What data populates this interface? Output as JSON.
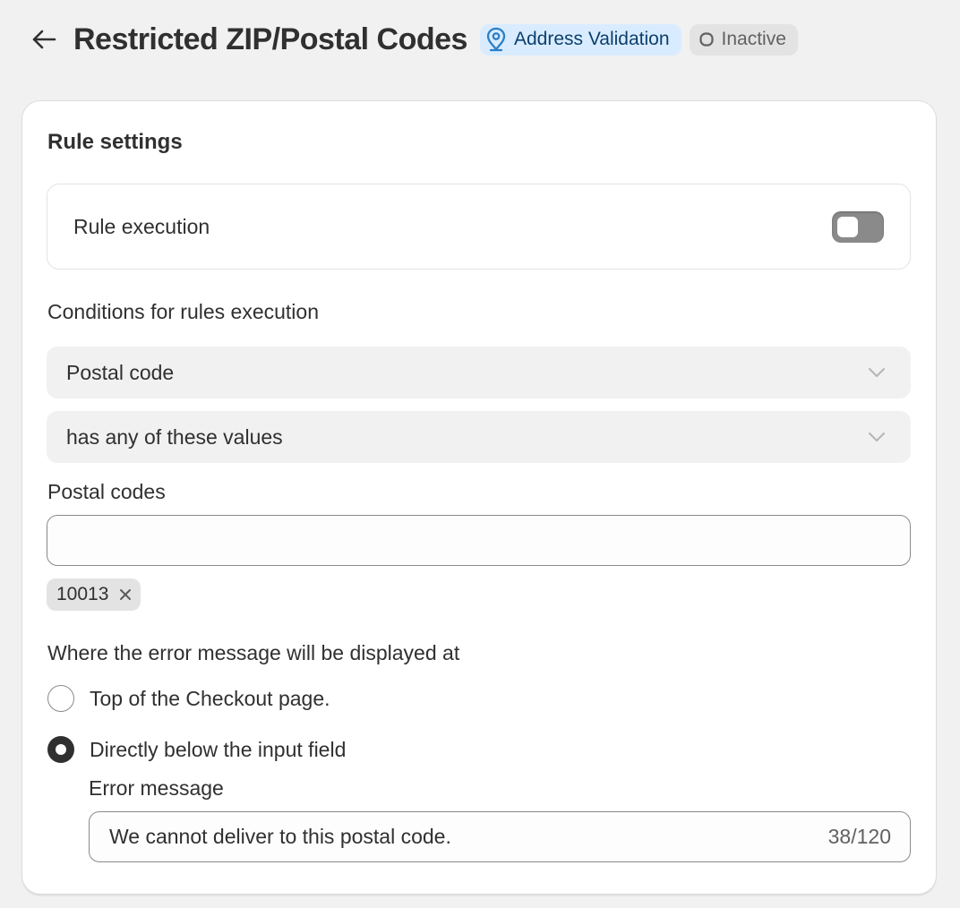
{
  "header": {
    "title": "Restricted ZIP/Postal Codes",
    "back_icon": "arrow-left-icon",
    "badges": [
      {
        "label": "Address Validation",
        "icon": "location-pin-icon",
        "color": "#d9ecff"
      },
      {
        "label": "Inactive",
        "icon": "circle-outline-icon",
        "color": "#e3e3e3"
      }
    ]
  },
  "rule_settings": {
    "title": "Rule settings",
    "execution": {
      "label": "Rule execution",
      "enabled": false
    },
    "conditions_label": "Conditions for rules execution",
    "field_select": {
      "value": "Postal code"
    },
    "operator_select": {
      "value": "has any of these values"
    },
    "postal_codes": {
      "label": "Postal codes",
      "input_value": "",
      "tags": [
        "10013"
      ]
    },
    "error_location": {
      "label": "Where the error message will be displayed at",
      "options": [
        {
          "label": "Top of the Checkout page.",
          "selected": false
        },
        {
          "label": "Directly below the input field",
          "selected": true
        }
      ]
    },
    "error_message": {
      "label": "Error message",
      "value": "We cannot deliver to this postal code.",
      "counter": "38/120"
    }
  }
}
